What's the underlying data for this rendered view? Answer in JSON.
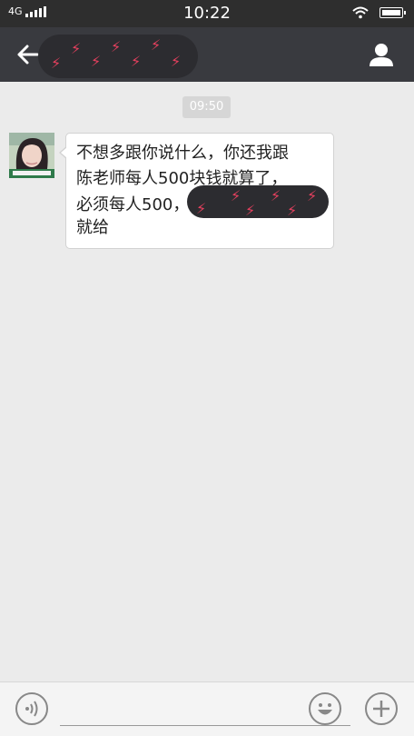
{
  "status_bar": {
    "network": "4G",
    "time": "10:22"
  },
  "header": {
    "back_icon": "arrow-left-icon",
    "contact_icon": "person-icon"
  },
  "chat": {
    "timestamp": "09:50",
    "message_lines": [
      "不想多跟你说什么，你还我跟",
      "陈老师每人500块钱就算了，",
      "必须每人500，",
      "就给"
    ]
  },
  "colors": {
    "statusbar": "#2e2e2e",
    "header": "#393a3f",
    "background": "#ebebeb"
  }
}
